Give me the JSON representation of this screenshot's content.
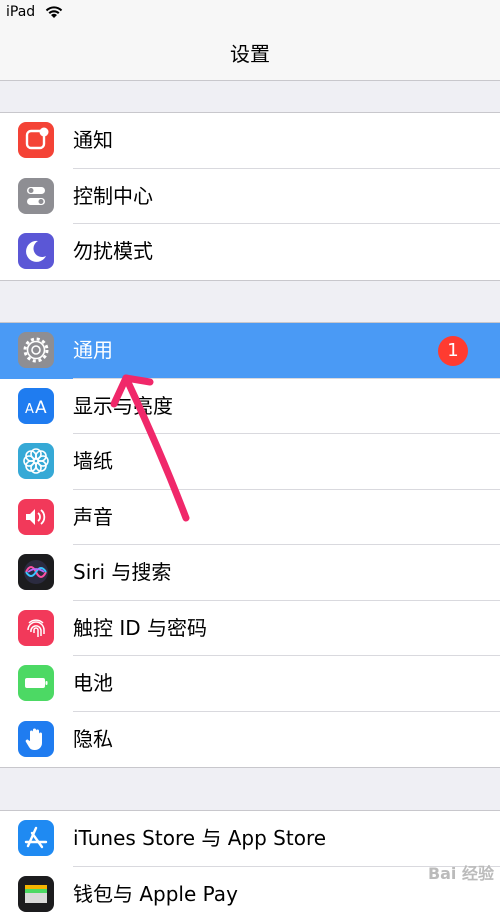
{
  "status_bar": {
    "carrier": "iPad"
  },
  "nav": {
    "title": "设置"
  },
  "group1": [
    {
      "label": "通知",
      "icon": "notifications-icon",
      "color": "#f44336"
    },
    {
      "label": "控制中心",
      "icon": "control-center-icon",
      "color": "#8e8e93"
    },
    {
      "label": "勿扰模式",
      "icon": "moon-icon",
      "color": "#5b57d6"
    }
  ],
  "group2": [
    {
      "label": "通用",
      "icon": "gear-icon",
      "color": "#8e8e93",
      "selected": true,
      "badge": "1"
    },
    {
      "label": "显示与亮度",
      "icon": "display-brightness-icon",
      "color": "#1f7cf0"
    },
    {
      "label": "墙纸",
      "icon": "wallpaper-icon",
      "color": "#36a9d6"
    },
    {
      "label": "声音",
      "icon": "speaker-icon",
      "color": "#f2395a"
    },
    {
      "label": "Siri 与搜索",
      "icon": "siri-icon",
      "color": "#1c1c1e"
    },
    {
      "label": "触控 ID 与密码",
      "icon": "fingerprint-icon",
      "color": "#f2395a"
    },
    {
      "label": "电池",
      "icon": "battery-icon",
      "color": "#4cd964"
    },
    {
      "label": "隐私",
      "icon": "hand-icon",
      "color": "#1f7cf0"
    }
  ],
  "group3": [
    {
      "label": "iTunes Store 与 App Store",
      "icon": "app-store-icon",
      "color": "#1f8af2"
    },
    {
      "label": "钱包与 Apple Pay",
      "icon": "wallet-icon",
      "color": "#1c1c1e"
    }
  ],
  "watermark": "Bai 经验"
}
